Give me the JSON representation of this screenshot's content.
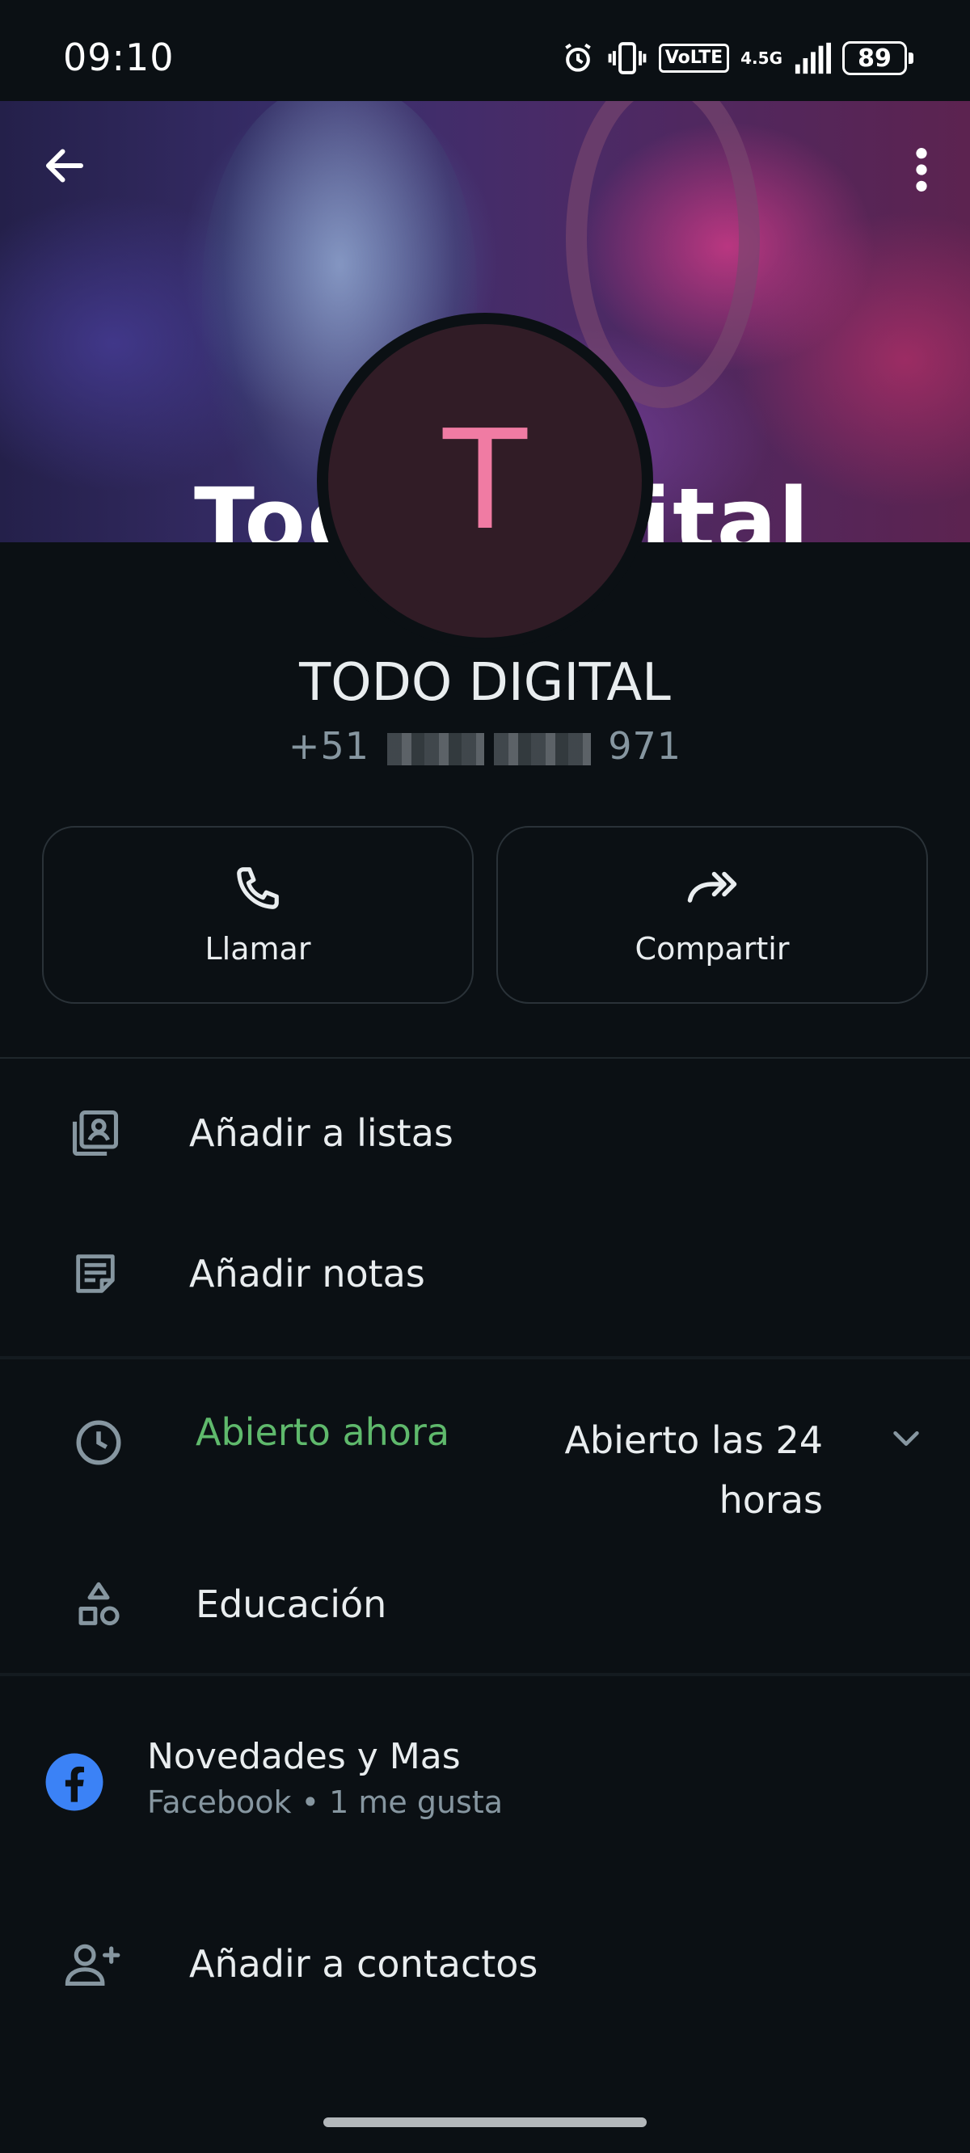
{
  "status_bar": {
    "time": "09:10",
    "network_label": "VoLTE",
    "network_type": "4.5G",
    "battery": "89"
  },
  "banner": {
    "text": "Todo Digital"
  },
  "contact": {
    "avatar_letter": "T",
    "name": "TODO DIGITAL",
    "phone_prefix": "+51",
    "phone_suffix": "971"
  },
  "actions": {
    "call_label": "Llamar",
    "share_label": "Compartir"
  },
  "menu": {
    "add_to_lists": "Añadir a listas",
    "add_notes": "Añadir notas"
  },
  "business": {
    "hours_status": "Abierto ahora",
    "hours_value": "Abierto las 24 horas",
    "category": "Educación"
  },
  "facebook": {
    "page_name": "Novedades y Mas",
    "subtitle": "Facebook • 1 me gusta"
  },
  "add_contact_label": "Añadir a contactos",
  "colors": {
    "background": "#0b1014",
    "accent_green": "#5fb96c",
    "avatar_bg": "#311c26",
    "avatar_letter": "#f07ba3",
    "facebook_blue": "#3b82f6"
  }
}
